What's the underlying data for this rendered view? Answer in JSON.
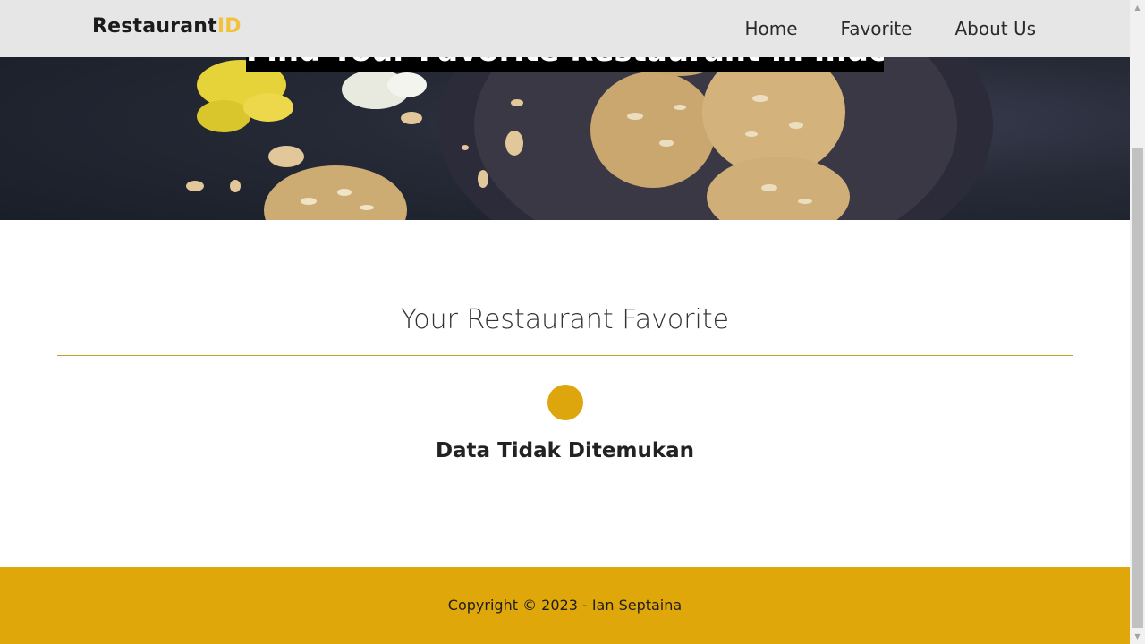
{
  "brand": {
    "name_main": "Restaurant",
    "name_accent": "ID"
  },
  "nav": {
    "items": [
      "Home",
      "Favorite",
      "About Us"
    ]
  },
  "hero": {
    "title": "Find Your Favorite Restaurant in Indonesia"
  },
  "main": {
    "section_title": "Your Restaurant Favorite",
    "empty_message": "Data Tidak Ditemukan",
    "loader_icon": "loading-spinner-icon"
  },
  "footer": {
    "copyright": "Copyright © 2023 - Ian Septaina"
  },
  "colors": {
    "appbar_bg": "#e6e6e6",
    "brand_accent": "#f2c23b",
    "footer_bg": "#e0a70a",
    "divider": "#b9a521",
    "loader": "#dea60d"
  },
  "scrollbar": {
    "up_icon": "scroll-up-arrow",
    "down_icon": "scroll-down-arrow"
  }
}
